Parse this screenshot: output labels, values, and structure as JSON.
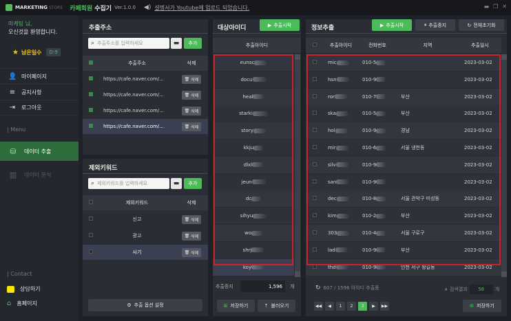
{
  "titlebar": {
    "brand": "MARKETING",
    "brand2": "STORE",
    "app_name": "카페회원",
    "app_name2": "수집기",
    "version": "Ver.1.0.0",
    "notice": "설명서가 Youtube에 업로드 되었습니다."
  },
  "sidebar": {
    "user_name": "마케팅 님,",
    "welcome": "오신것을 환영합니다.",
    "days_label": "남은일수",
    "days_value": "D-9",
    "nav": [
      {
        "label": "마이페이지",
        "icon": "user-icon"
      },
      {
        "label": "공지사항",
        "icon": "list-icon"
      },
      {
        "label": "로그아웃",
        "icon": "logout-icon"
      }
    ],
    "menu_label": "| Menu",
    "menu": [
      {
        "label": "데이터 추출",
        "icon": "database-icon"
      },
      {
        "label": "데이터 분석",
        "icon": "chart-icon"
      }
    ],
    "contact_label": "| Contact",
    "contacts": [
      {
        "label": "상담하기",
        "icon": "kakao-icon"
      },
      {
        "label": "홈페이지",
        "icon": "home-icon"
      }
    ]
  },
  "extract": {
    "title": "추출주소",
    "search_placeholder": "추출주소를 입력하세요",
    "add_label": "추가",
    "col_address": "추출주소",
    "col_delete": "삭제",
    "delete_label": "삭제",
    "rows": [
      "https://cafe.naver.com/...",
      "https://cafe.naver.com/...",
      "https://cafe.naver.com/...",
      "https://cafe.naver.com/..."
    ]
  },
  "exclude": {
    "title": "제외키워드",
    "search_placeholder": "제외키워드를 입력하세요",
    "add_label": "추가",
    "col_keyword": "제외키워드",
    "col_delete": "삭제",
    "delete_label": "삭제",
    "rows": [
      "신고",
      "광고",
      "사기"
    ],
    "settings_label": "추출 옵션 설정"
  },
  "target": {
    "title": "대상아이디",
    "start_label": "추출시작",
    "col_id": "추출아이디",
    "rows": [
      "eunsc",
      "docu",
      "heal",
      "starki",
      "story",
      "kkju",
      "dlxl",
      "jeun",
      "dc",
      "sihyu",
      "wo",
      "shrj",
      "koy"
    ],
    "count_label": "추출증지",
    "count_value": "1,596",
    "count_unit": "개",
    "save_label": "저장하기",
    "load_label": "불러오기"
  },
  "info": {
    "title": "정보추출",
    "start_label": "추출시작",
    "stop_label": "추출중지",
    "reset_label": "전체초기화",
    "cols": [
      "추출아이디",
      "전화번호",
      "지역",
      "추출일시"
    ],
    "rows": [
      {
        "id": "mic",
        "phone": "010-5",
        "region": "",
        "date": "2023-03-02"
      },
      {
        "id": "hsn",
        "phone": "010-9",
        "region": "",
        "date": "2023-03-02"
      },
      {
        "id": "ror",
        "phone": "010-7",
        "region": "부산",
        "date": "2023-03-02"
      },
      {
        "id": "ska",
        "phone": "010-5",
        "region": "부산",
        "date": "2023-03-02"
      },
      {
        "id": "hol",
        "phone": "010-9",
        "region": "경남",
        "date": "2023-03-02"
      },
      {
        "id": "mir",
        "phone": "010-6",
        "region": "서울 냉천동",
        "date": "2023-03-02"
      },
      {
        "id": "silv",
        "phone": "010-9",
        "region": "",
        "date": "2023-03-02"
      },
      {
        "id": "san",
        "phone": "010-9",
        "region": "",
        "date": "2023-03-02"
      },
      {
        "id": "dec",
        "phone": "010-8",
        "region": "서울 관악구 미성동",
        "date": "2023-03-02"
      },
      {
        "id": "kim",
        "phone": "010-2",
        "region": "부산",
        "date": "2023-03-02"
      },
      {
        "id": "303",
        "phone": "010-4",
        "region": "서울 구로구",
        "date": "2023-03-02"
      },
      {
        "id": "lad",
        "phone": "010-9",
        "region": "부산",
        "date": "2023-03-02"
      },
      {
        "id": "thd",
        "phone": "010-9",
        "region": "인천 서구 왕길동",
        "date": "2023-03-02"
      }
    ],
    "progress_text": "607 / 1596 아이디 추출중",
    "result_label": "검색결과",
    "result_value": "58",
    "result_unit": "개",
    "pages": [
      "1",
      "2",
      "3"
    ],
    "active_page": "3",
    "save_label": "저장하기"
  }
}
